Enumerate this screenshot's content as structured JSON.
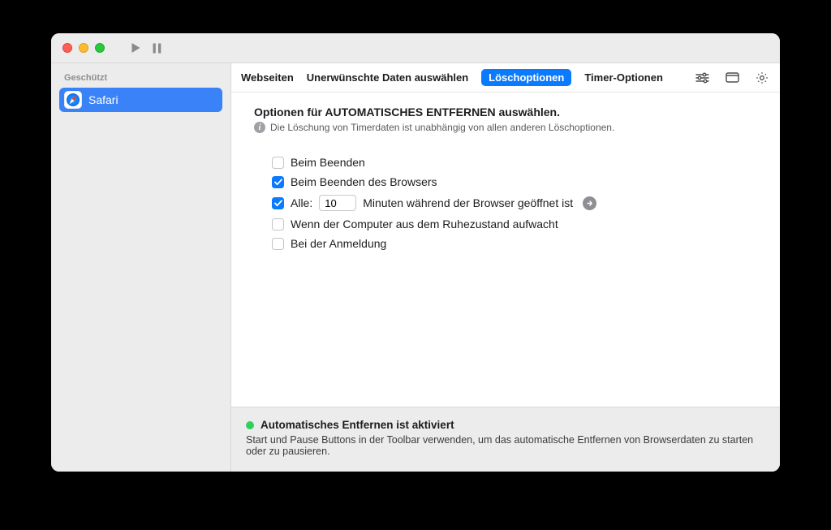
{
  "sidebar": {
    "header": "Geschützt",
    "items": [
      {
        "label": "Safari"
      }
    ]
  },
  "tabs": {
    "websites": "Webseiten",
    "unwanted": "Unerwünschte Daten auswählen",
    "delete_opts": "Löschoptionen",
    "timer_opts": "Timer-Optionen"
  },
  "section": {
    "title": "Optionen für AUTOMATISCHES ENTFERNEN auswählen.",
    "info": "Die Löschung von Timerdaten ist unabhängig von allen anderen Löschoptionen."
  },
  "options": {
    "on_quit": "Beim Beenden",
    "on_browser_quit": "Beim Beenden des Browsers",
    "every_prefix": "Alle:",
    "every_value": "10",
    "every_suffix": "Minuten während der Browser geöffnet ist",
    "on_wake": "Wenn der Computer aus dem Ruhezustand aufwacht",
    "on_login": "Bei der Anmeldung"
  },
  "footer": {
    "status": "Automatisches Entfernen ist aktiviert",
    "hint": "Start und Pause Buttons in der Toolbar verwenden, um das automatische Entfernen von Browserdaten zu starten oder zu pausieren."
  }
}
